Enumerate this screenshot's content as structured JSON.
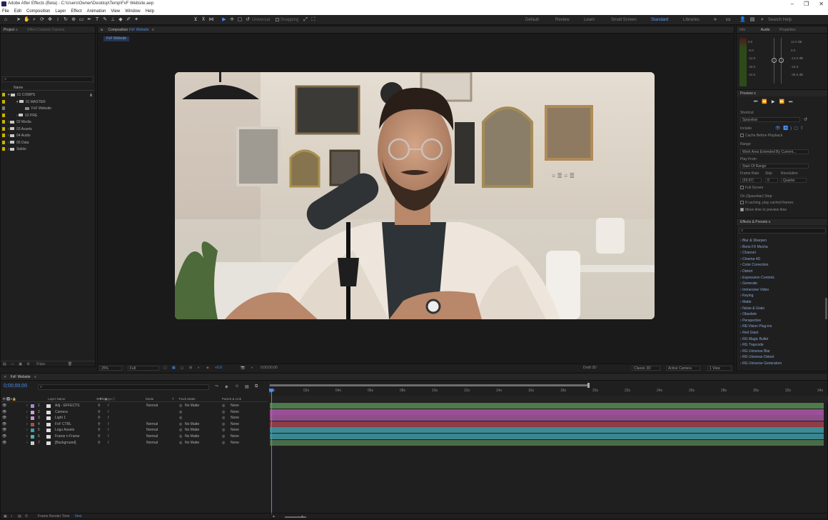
{
  "window": {
    "title": "Adobe After Effects (Beta) - C:\\Users\\Owner\\Desktop\\Temp\\FxF Website.aep"
  },
  "menu": [
    "File",
    "Edit",
    "Composition",
    "Layer",
    "Effect",
    "Animation",
    "View",
    "Window",
    "Help"
  ],
  "toolbar": {
    "universal": "Universal",
    "snapping": "Snapping"
  },
  "workspaces": [
    "Default",
    "Review",
    "Learn",
    "Small Screen",
    "Standard",
    "Libraries"
  ],
  "workspace_active": "Standard",
  "search_help": "Search Help",
  "project": {
    "tab": "Project",
    "tab2": "Effect Controls Camera",
    "col_name": "Name",
    "items": [
      {
        "label": "01 COMPS",
        "indent": 0
      },
      {
        "label": "01 MASTER",
        "indent": 1
      },
      {
        "label": "FxF Website",
        "indent": 2
      },
      {
        "label": "02 PRE",
        "indent": 1
      },
      {
        "label": "02 Media",
        "indent": 0
      },
      {
        "label": "03 Assets",
        "indent": 0
      },
      {
        "label": "04 Audio",
        "indent": 0
      },
      {
        "label": "05 Data",
        "indent": 0
      },
      {
        "label": "Solids",
        "indent": 0
      }
    ],
    "bpc": "8 bpc"
  },
  "composition": {
    "tab_prefix": "Composition",
    "tab_name": "FxF Website",
    "flowchart": "FxF Website",
    "zoom": "25%",
    "resolution": "Full",
    "exposure": "+0.0",
    "timecode": "0;00;00;00",
    "renderer": "Draft 3D",
    "renderer_mode": "Classic 3D",
    "camera": "Active Camera",
    "views": "1 View"
  },
  "right_panel": {
    "tab_info": "Info",
    "tab_audio": "Audio",
    "tab_properties": "Properties",
    "audio_db_left": [
      "0.0",
      "-6.0",
      "-12.0",
      "-18.0",
      "-24.0"
    ],
    "audio_db_right": [
      "12.0 dB",
      "0.0",
      "-12.0 dB",
      "-24.0",
      "-36.0 dB"
    ],
    "preview": {
      "title": "Preview",
      "shortcut_label": "Shortcut",
      "shortcut": "Spacebar",
      "include_label": "Include",
      "cache_before": "Cache Before Playback",
      "range_label": "Range",
      "range": "Work Area Extended By Current...",
      "play_from_label": "Play From",
      "play_from": "Start Of Range",
      "frame_rate_label": "Frame Rate",
      "skip_label": "Skip",
      "resolution_label": "Resolution",
      "frame_rate": "(29.97)",
      "skip": "0",
      "resolution": "Quarter",
      "full_screen": "Full Screen",
      "on_stop": "On (Spacebar) Stop",
      "if_caching": "If caching, play cached frames",
      "move_time": "Move time to preview time"
    },
    "effects": {
      "title": "Effects & Presets",
      "items": [
        "Blur & Sharpen",
        "Boris FX Mocha",
        "Channel",
        "Cinema 4D",
        "Color Correction",
        "Distort",
        "Expression Controls",
        "Generate",
        "Immersive Video",
        "Keying",
        "Matte",
        "Noise & Grain",
        "Obsolete",
        "Perspective",
        "RE:Vision Plug-ins",
        "Red Giant",
        "RG Magic Bullet",
        "RG Trapcode",
        "RG Universe Blur",
        "RG Universe Distort",
        "RG Universe Generators"
      ]
    }
  },
  "timeline": {
    "tab": "FxF Website",
    "timecode": "0;00;00;00",
    "col_layer_name": "Layer Name",
    "col_mode": "Mode",
    "col_t": "T",
    "col_trkmat": "Track Matte",
    "col_parent": "Parent & Link",
    "ruler": [
      "0s",
      "02s",
      "04s",
      "06s",
      "08s",
      "10s",
      "12s",
      "14s",
      "16s",
      "18s",
      "20s",
      "22s",
      "24s",
      "26s",
      "28s",
      "30s",
      "32s",
      "34s"
    ],
    "layers": [
      {
        "num": "1",
        "name": "Adj - EFFECTS",
        "mode": "Normal",
        "matte": "No Matte",
        "parent": "None",
        "color": "#a08cd6",
        "track": "#4f7a4a"
      },
      {
        "num": "2",
        "name": "Camera",
        "mode": "",
        "matte": "",
        "parent": "None",
        "color": "#c9a3d8",
        "track": "#9a4f99"
      },
      {
        "num": "3",
        "name": "Light 1",
        "mode": "",
        "matte": "",
        "parent": "None",
        "color": "#c49ac0",
        "track": "#8f4e8a"
      },
      {
        "num": "4",
        "name": "FxF CTRL",
        "mode": "Normal",
        "matte": "No Matte",
        "parent": "None",
        "color": "#b24a4a",
        "track": "#8c3d46"
      },
      {
        "num": "5",
        "name": "Logo Assets",
        "mode": "Normal",
        "matte": "No Matte",
        "parent": "None",
        "color": "#3f9db1",
        "track": "#3e8a95"
      },
      {
        "num": "6",
        "name": "Frame n Frame",
        "mode": "Normal",
        "matte": "No Matte",
        "parent": "None",
        "color": "#4bb0b8",
        "track": "#3b868e"
      },
      {
        "num": "7",
        "name": "[Background]",
        "mode": "Normal",
        "matte": "No Matte",
        "parent": "None",
        "color": "#cccccc",
        "track": "#4a6b48"
      }
    ],
    "footer": "Frame Render Time",
    "footer_value": "0ms"
  }
}
